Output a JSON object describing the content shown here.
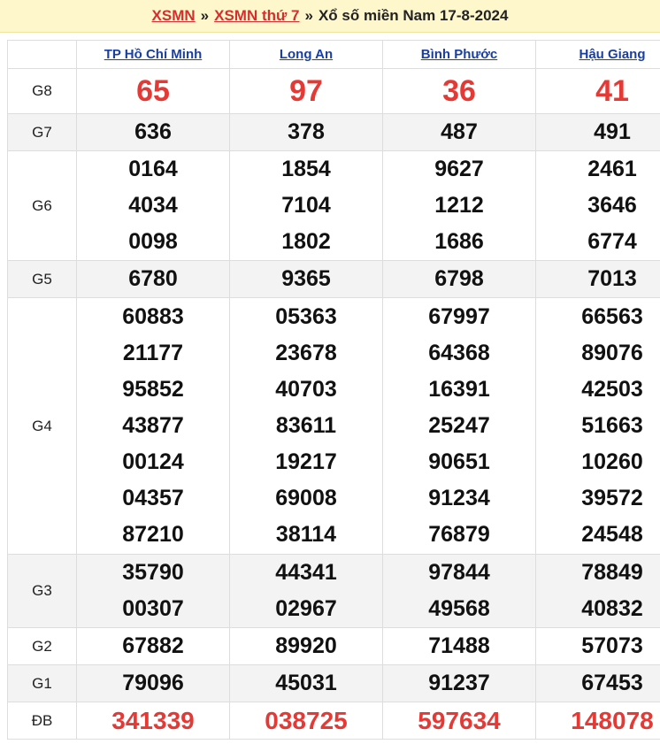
{
  "header": {
    "link1": "XSMN",
    "sep1": "»",
    "link2": "XSMN thứ 7",
    "sep2": "»",
    "title": "Xổ số miền Nam 17-8-2024"
  },
  "provinces": [
    "TP Hồ Chí Minh",
    "Long An",
    "Bình Phước",
    "Hậu Giang"
  ],
  "prizes": {
    "g8": {
      "label": "G8",
      "values": [
        "65",
        "97",
        "36",
        "41"
      ]
    },
    "g7": {
      "label": "G7",
      "values": [
        "636",
        "378",
        "487",
        "491"
      ]
    },
    "g6": {
      "label": "G6",
      "values": [
        [
          "0164",
          "4034",
          "0098"
        ],
        [
          "1854",
          "7104",
          "1802"
        ],
        [
          "9627",
          "1212",
          "1686"
        ],
        [
          "2461",
          "3646",
          "6774"
        ]
      ]
    },
    "g5": {
      "label": "G5",
      "values": [
        "6780",
        "9365",
        "6798",
        "7013"
      ]
    },
    "g4": {
      "label": "G4",
      "values": [
        [
          "60883",
          "21177",
          "95852",
          "43877",
          "00124",
          "04357",
          "87210"
        ],
        [
          "05363",
          "23678",
          "40703",
          "83611",
          "19217",
          "69008",
          "38114"
        ],
        [
          "67997",
          "64368",
          "16391",
          "25247",
          "90651",
          "91234",
          "76879"
        ],
        [
          "66563",
          "89076",
          "42503",
          "51663",
          "10260",
          "39572",
          "24548"
        ]
      ]
    },
    "g3": {
      "label": "G3",
      "values": [
        [
          "35790",
          "00307"
        ],
        [
          "44341",
          "02967"
        ],
        [
          "97844",
          "49568"
        ],
        [
          "78849",
          "40832"
        ]
      ]
    },
    "g2": {
      "label": "G2",
      "values": [
        "67882",
        "89920",
        "71488",
        "57073"
      ]
    },
    "g1": {
      "label": "G1",
      "values": [
        "79096",
        "45031",
        "91237",
        "67453"
      ]
    },
    "db": {
      "label": "ĐB",
      "values": [
        "341339",
        "038725",
        "597634",
        "148078"
      ]
    }
  }
}
